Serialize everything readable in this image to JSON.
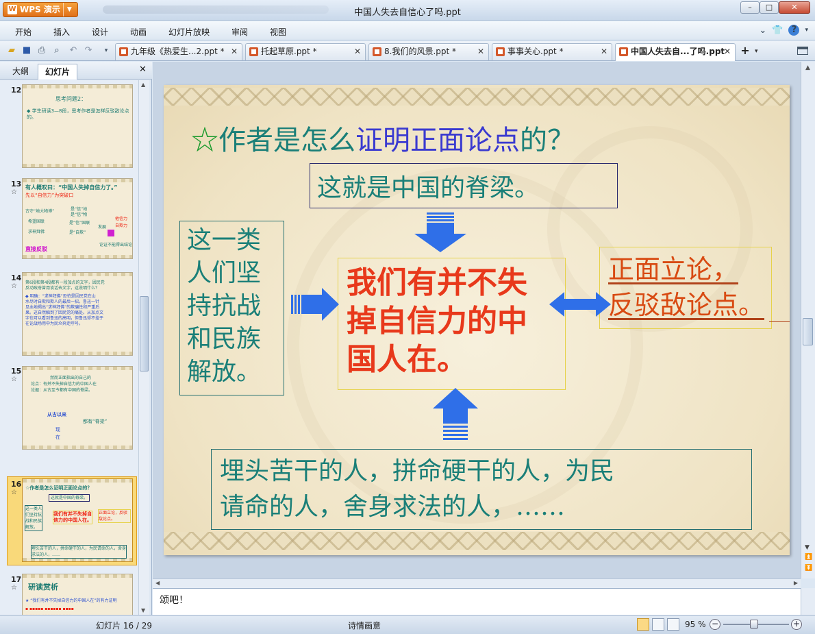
{
  "app": {
    "name": "WPS 演示",
    "doc_title": "中国人失去自信心了吗.ppt",
    "window_buttons": {
      "minimize": "–",
      "maximize": "□",
      "close": "✕"
    }
  },
  "menu": [
    "开始",
    "插入",
    "设计",
    "动画",
    "幻灯片放映",
    "审阅",
    "视图"
  ],
  "tabs": [
    {
      "label": "九年级《热爱生...2.ppt *"
    },
    {
      "label": "托起草原.ppt *"
    },
    {
      "label": "8.我们的风景.ppt *"
    },
    {
      "label": "事事关心.ppt *"
    },
    {
      "label": "中国人失去自...了吗.ppt",
      "active": true
    }
  ],
  "panel": {
    "tab_outline": "大纲",
    "tab_slides": "幻灯片",
    "close": "✕",
    "thumbnails": [
      {
        "num": "12",
        "lines": [
          "思考问题2：",
          "◆ 学生研读3—8段，思考作者是怎样反驳敌论点的。"
        ]
      },
      {
        "num": "13",
        "lines": [
          "有人概叹曰：“中国人失掉自信力了。”",
          "先以“自信力”为突破口",
          "古守“地大物博”",
          "希望国联",
          "求神拜佛",
          "是“信”地",
          "是“信”物",
          "是“信”国联",
          "是“自欺”",
          "发展",
          "他信力",
          "自欺力",
          "论证不能得出结论",
          "直接反驳"
        ]
      },
      {
        "num": "14",
        "lines": [
          "第6段和第4段都有一段加点的文字，因民党",
          "反动政府曾用谈话去文字，这说明什么？",
          "◆ 明确：“求神拜佛”恐怕是因民党在山",
          "水尽时自欺和欺人的最后一招。鲁迅一针",
          "见血地揭出“求神拜佛”的欺骗性和严重后",
          "果。这自然触到了因民党的痛处。从加点文",
          "字也可以看到鲁迅的高明，但鲁迅却不挂于",
          "在论战场用中为民众奔走呼号。"
        ]
      },
      {
        "num": "15",
        "lines": [
          "然而正面指出的自己的",
          "论点：有并不失掉自信力的中国人在",
          "论据：从古至今都有中国的脊梁。",
          "从古以来",
          "都有“脊梁”",
          "现",
          "在"
        ]
      },
      {
        "num": "16",
        "lines": [
          "☆作者是怎么证明正面论点的？",
          "这就是中国的脊梁。",
          "这一类人们坚持抗战和民族解放。",
          "我们有并不失掉自信力的中国人在。",
          "正面立论，反驳敌论点。",
          "埋头苦干的人，拼命硬干的人，为民请命的人，舍身求法的人，……"
        ]
      },
      {
        "num": "17",
        "lines": [
          "研读赏析",
          "★ “我们有并不失掉自信力的中国人在”的有力证明"
        ]
      }
    ]
  },
  "slide": {
    "title_star": "☆",
    "title_pre": "作者是怎么",
    "title_highlight": "证明正面论点",
    "title_post": "的？",
    "box_top": "这就是中国的脊梁。",
    "box_left": [
      "这一类",
      "人们坚",
      "持抗战",
      "和民族",
      "解放。"
    ],
    "box_center": [
      "我们有并不失",
      "掉自信力的中",
      "国人在。"
    ],
    "box_right": [
      "正面立论，",
      "反驳敌论点。"
    ],
    "box_bottom": [
      "埋头苦干的人，拼命硬干的人，为民",
      "请命的人，舍身求法的人，……"
    ]
  },
  "notes": "颂吧！",
  "status": {
    "slide_counter": "幻灯片 16 / 29",
    "theme": "诗情画意",
    "zoom": "95 %"
  },
  "colors": {
    "title_teal": "#1a7f78",
    "title_blue": "#3a3ad0",
    "center_red": "#e8391b",
    "right_orange": "#d84a12",
    "arrow_blue": "#2f6fe8",
    "star_green": "#1b9a2d"
  }
}
